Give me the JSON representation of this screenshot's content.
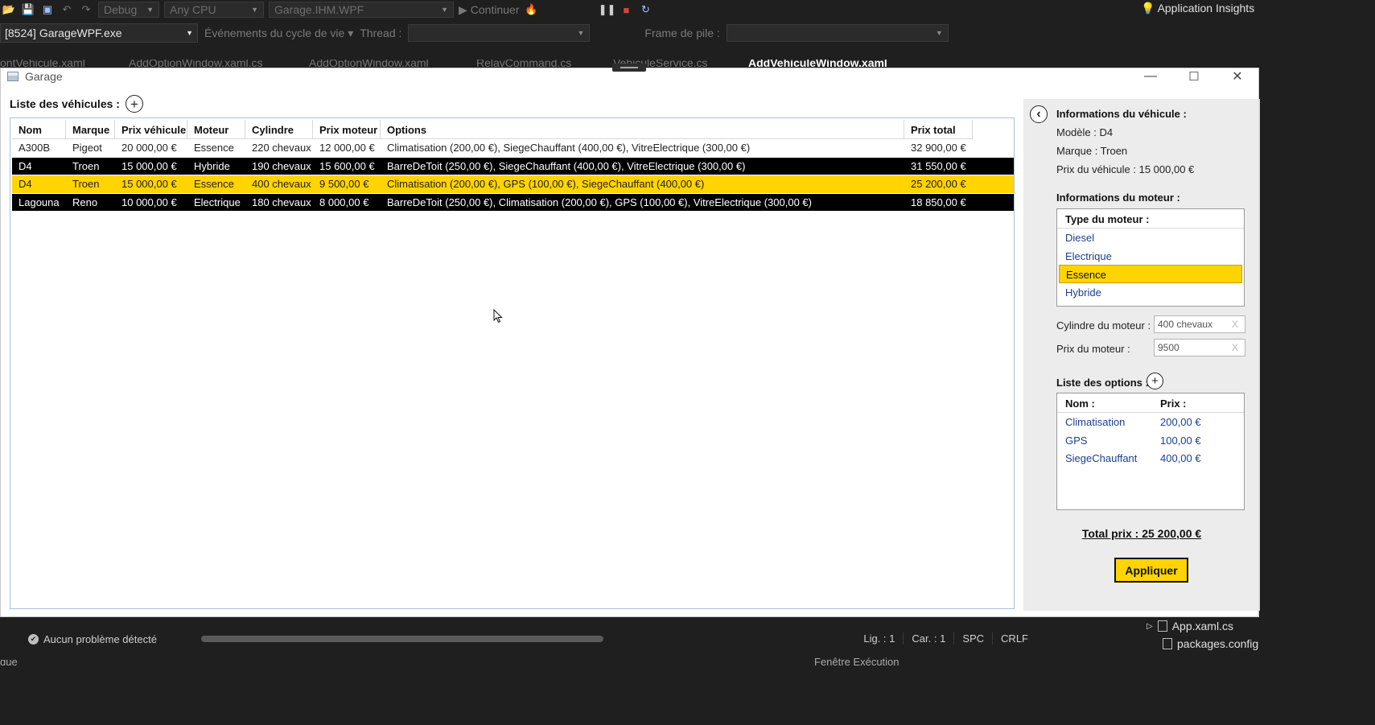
{
  "vs": {
    "config": "Debug",
    "platform": "Any CPU",
    "project": "Garage.IHM.WPF",
    "continue": "Continuer",
    "insights": "Application Insights",
    "process": "[8524] GarageWPF.exe",
    "lifecycle": "Événements du cycle de vie",
    "thread": "Thread :",
    "frame": "Frame de pile :",
    "tabs": [
      "ontVehicule.xaml",
      "AddOptionWindow.xaml.cs",
      "AddOptionWindow.xaml",
      "RelayCommand.cs",
      "VehiculeService.cs",
      "AddVehiculeWindow.xaml"
    ]
  },
  "window": {
    "title": "Garage",
    "minimize": "—",
    "maximize": "☐",
    "close": "✕"
  },
  "list": {
    "title": "Liste des véhicules :",
    "add": "+",
    "columns": [
      "Nom",
      "Marque",
      "Prix véhicule",
      "Moteur",
      "Cylindre",
      "Prix moteur",
      "Options",
      "Prix total"
    ],
    "rows": [
      {
        "nom": "A300B",
        "marque": "Pigeot",
        "prix": "20 000,00 €",
        "moteur": "Essence",
        "cylindre": "220 chevaux",
        "prix_moteur": "12 000,00 €",
        "options": "Climatisation (200,00 €), SiegeChauffant (400,00 €), VitreElectrique (300,00 €)",
        "total": "32 900,00 €"
      },
      {
        "nom": "D4",
        "marque": "Troen",
        "prix": "15 000,00 €",
        "moteur": "Hybride",
        "cylindre": "190 chevaux",
        "prix_moteur": "15 600,00 €",
        "options": "BarreDeToit (250,00 €), SiegeChauffant (400,00 €), VitreElectrique (300,00 €)",
        "total": "31 550,00 €"
      },
      {
        "nom": "D4",
        "marque": "Troen",
        "prix": "15 000,00 €",
        "moteur": "Essence",
        "cylindre": "400 chevaux",
        "prix_moteur": "9 500,00 €",
        "options": "Climatisation (200,00 €), GPS (100,00 €), SiegeChauffant (400,00 €)",
        "total": "25 200,00 €"
      },
      {
        "nom": "Lagouna",
        "marque": "Reno",
        "prix": "10 000,00 €",
        "moteur": "Electrique",
        "cylindre": "180 chevaux",
        "prix_moteur": "8 000,00 €",
        "options": "BarreDeToit (250,00 €), Climatisation (200,00 €), GPS (100,00 €), VitreElectrique (300,00 €)",
        "total": "18 850,00 €"
      }
    ]
  },
  "panel": {
    "back": "‹",
    "vehicle_heading": "Informations du véhicule :",
    "model": "Modèle : D4",
    "brand": "Marque : Troen",
    "price": "Prix du véhicule : 15 000,00 €",
    "engine_heading": "Informations du moteur :",
    "engine_type_header": "Type du moteur :",
    "engine_types": [
      "Diesel",
      "Electrique",
      "Essence",
      "Hybride"
    ],
    "selected_engine": "Essence",
    "cyl_label": "Cylindre du moteur :",
    "cyl_value": "400 chevaux",
    "price_label": "Prix du moteur :",
    "price_value": "9500",
    "clear": "X",
    "options_heading": "Liste des options :",
    "options_add": "+",
    "options_cols": [
      "Nom :",
      "Prix :"
    ],
    "options": [
      {
        "nom": "Climatisation",
        "prix": "200,00 €"
      },
      {
        "nom": "GPS",
        "prix": "100,00 €"
      },
      {
        "nom": "SiegeChauffant",
        "prix": "400,00 €"
      }
    ],
    "total": "Total prix : 25 200,00 €",
    "apply": "Appliquer"
  },
  "status": {
    "problems": "Aucun problème détecté",
    "line": "Lig. : 1",
    "col": "Car. : 1",
    "spc": "SPC",
    "crlf": "CRLF"
  },
  "solution": {
    "items": [
      "App.xaml.cs",
      "packages.config"
    ]
  },
  "bottom": {
    "left": "que",
    "right": "Fenêtre Exécution"
  },
  "colors": {
    "selected": "#ffd400",
    "dark_row": "#000000",
    "link": "#1c3f8e"
  }
}
